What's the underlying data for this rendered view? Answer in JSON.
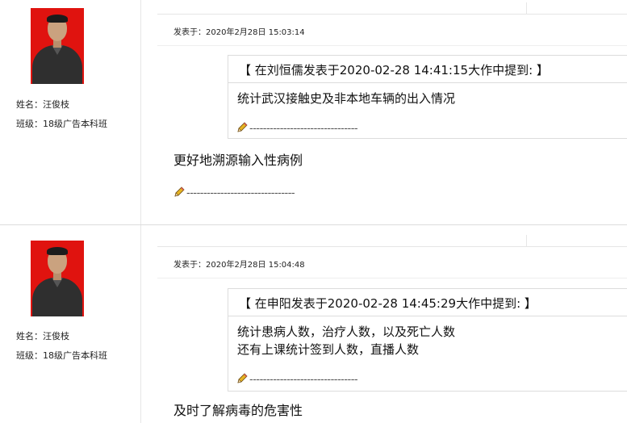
{
  "posts": [
    {
      "user_name_label": "姓名：汪俊枝",
      "user_class_label": "班级：18级广告本科班",
      "posted_at": "发表于：2020年2月28日  15:03:14",
      "quote_header": "【 在刘恒儒发表于2020-02-28 14:41:15大作中提到: 】",
      "quote_lines": [
        "统计武汉接触史及非本地车辆的出入情况"
      ],
      "quote_signature": "--------------------------------",
      "reply_text": "更好地溯源输入性病例",
      "reply_signature": "--------------------------------"
    },
    {
      "user_name_label": "姓名：汪俊枝",
      "user_class_label": "班级：18级广告本科班",
      "posted_at": "发表于：2020年2月28日  15:04:48",
      "quote_header": "【 在申阳发表于2020-02-28 14:45:29大作中提到: 】",
      "quote_lines": [
        "统计患病人数，治疗人数，以及死亡人数",
        "还有上课统计签到人数，直播人数"
      ],
      "quote_signature": "--------------------------------",
      "reply_text": "及时了解病毒的危害性"
    }
  ],
  "icons": {
    "signature": "pencil-icon",
    "avatar": "avatar-photo"
  },
  "colors": {
    "avatar_bg": "#e0130f",
    "divider": "#dcdcdc"
  }
}
